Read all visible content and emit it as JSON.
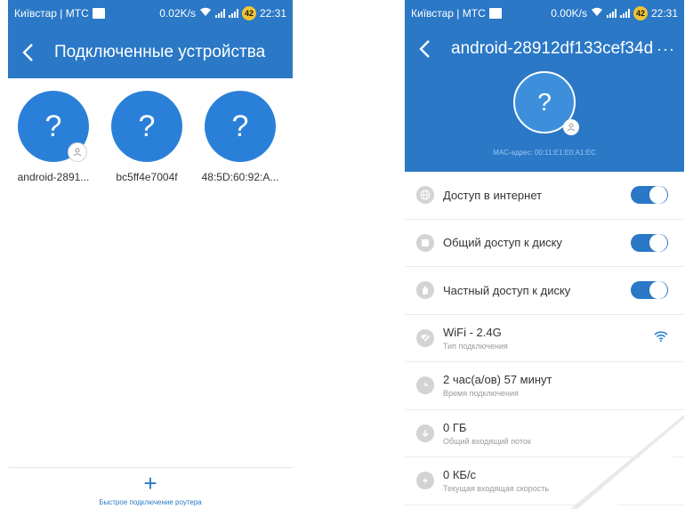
{
  "left": {
    "status": {
      "carrier": "Київстар | МТС",
      "speed": "0.02K/s",
      "battery": "42",
      "time": "22:31"
    },
    "title": "Подключенные устройства",
    "devices": [
      {
        "name": "android-2891...",
        "icon": "?"
      },
      {
        "name": "bc5ff4e7004f",
        "icon": "?"
      },
      {
        "name": "48:5D:60:92:A...",
        "icon": "?"
      }
    ],
    "quick_connect_label": "Быстрое подключение роутера",
    "plus": "+"
  },
  "right": {
    "status": {
      "carrier": "Київстар | МТС",
      "speed": "0.00K/s",
      "battery": "42",
      "time": "22:31"
    },
    "title": "android-28912df133cef34d",
    "more": "···",
    "device_icon": "?",
    "mac": "MAC-адрес: 00:11:E1:E0:A1:EC",
    "rows": {
      "internet": {
        "label": "Доступ в интернет",
        "enabled": true
      },
      "shared_disk": {
        "label": "Общий доступ к диску",
        "enabled": true
      },
      "private_disk": {
        "label": "Частный доступ к диску",
        "enabled": true
      },
      "connection": {
        "label": "WiFi - 2.4G",
        "sub": "Тип подключения"
      },
      "time": {
        "label": "2 час(а/ов) 57 минут",
        "sub": "Время подключения"
      },
      "total_in": {
        "label": "0 ГБ",
        "sub": "Общий входящий поток"
      },
      "speed_in": {
        "label": "0 КБ/с",
        "sub": "Текущая входящая скорость"
      }
    }
  },
  "colors": {
    "primary": "#2a78c6",
    "toggle_on": "#2a78c6",
    "icon_gray": "#d3d3d3"
  }
}
